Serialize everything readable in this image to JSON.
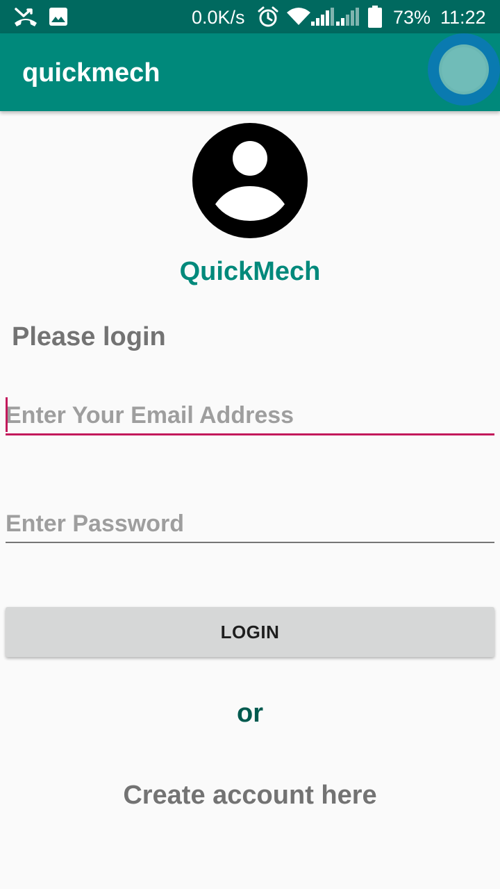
{
  "status_bar": {
    "network_speed": "0.0K/s",
    "battery": "73%",
    "time": "11:22",
    "icons": [
      "missed-call-icon",
      "image-icon",
      "alarm-icon",
      "wifi-icon",
      "signal-icon",
      "signal-icon",
      "battery-icon"
    ]
  },
  "app_bar": {
    "title": "quickmech"
  },
  "main": {
    "avatar_icon": "account-circle-icon",
    "brand": "QuickMech",
    "heading": "Please login",
    "email_placeholder": "Enter Your Email Address",
    "password_placeholder": "Enter Password",
    "login_label": "LOGIN",
    "or_text": "or",
    "create_account": "Create account here"
  },
  "colors": {
    "status_bar": "#00695f",
    "app_bar": "#00897b",
    "accent": "#c2185b",
    "brand_text": "#00897b",
    "or_text": "#005a4f",
    "button_bg": "#d6d7d7"
  }
}
